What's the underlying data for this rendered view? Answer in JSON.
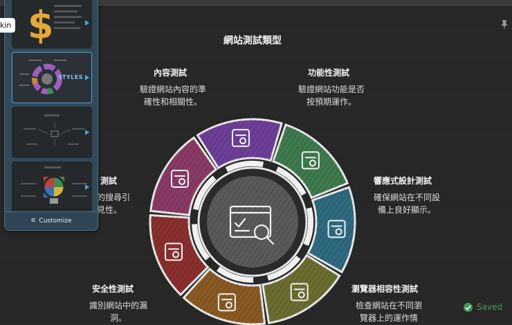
{
  "document": {
    "title": "網站測試類型",
    "sections": [
      {
        "id": "content",
        "title": "內容測試",
        "desc_lines": [
          "驗證網站內容的準",
          "確性和相關性。"
        ],
        "color": "#6d3f98",
        "icon": "book-search-icon"
      },
      {
        "id": "functional",
        "title": "功能性測試",
        "desc_lines": [
          "驗證網站功能是否",
          "按預期運作。"
        ],
        "color": "#3f7a4e",
        "icon": "monitor-check-icon"
      },
      {
        "id": "responsive",
        "title": "響應式設計測試",
        "desc_lines": [
          "確保網站在不同設",
          "備上良好顯示。"
        ],
        "color": "#2f6a80",
        "icon": "devices-icon"
      },
      {
        "id": "browser",
        "title": "瀏覽器相容性測試",
        "desc_lines": [
          "檢查網站在不同瀏",
          "覽器上的運作情"
        ],
        "color": "#6b6d30",
        "icon": "game-controller-icon"
      },
      {
        "id": "performance",
        "title": "",
        "desc_lines": [],
        "color": "#8a5a23",
        "icon": "speedometer-icon"
      },
      {
        "id": "security",
        "title": "安全性測試",
        "desc_lines": [
          "識別網站中的漏",
          "洞。"
        ],
        "color": "#8a2f2f",
        "icon": "shield-icon"
      },
      {
        "id": "seo",
        "title": "測試",
        "desc_lines": [
          "的搜尋引",
          "見性。"
        ],
        "color": "#8a3a66",
        "icon": "window-search-icon"
      }
    ],
    "center_icon": "browser-search-icon"
  },
  "panel": {
    "styles_label": "STYLES",
    "customize_label": "Customize",
    "skin_label": "kin"
  },
  "status": {
    "saved_label": "Saved"
  },
  "colors": {
    "accent": "#4aa8d8",
    "saved": "#3f9a53"
  }
}
